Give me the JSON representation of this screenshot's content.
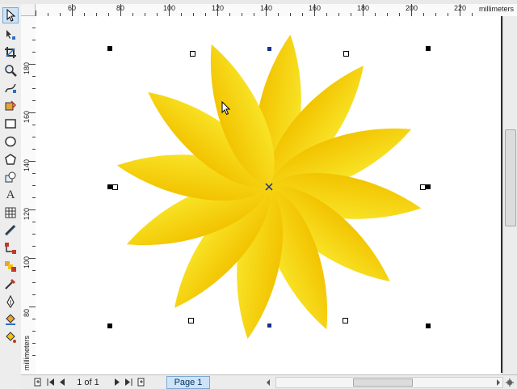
{
  "app": {
    "ruler_units": "millimeters",
    "horizontal_ticks": [
      "60",
      "80",
      "100",
      "120",
      "140",
      "160",
      "180",
      "200",
      "220"
    ],
    "vertical_ticks": [
      "180",
      "160",
      "140",
      "120",
      "100",
      "80"
    ],
    "vertical_units": "millimeters"
  },
  "toolbox": {
    "tools": [
      {
        "name": "pick-tool-icon",
        "selected": true
      },
      {
        "name": "shape-tool-icon",
        "selected": false
      },
      {
        "name": "crop-tool-icon",
        "selected": false
      },
      {
        "name": "zoom-tool-icon",
        "selected": false
      },
      {
        "name": "freehand-tool-icon",
        "selected": false
      },
      {
        "name": "smart-fill-tool-icon",
        "selected": false
      },
      {
        "name": "rectangle-tool-icon",
        "selected": false
      },
      {
        "name": "ellipse-tool-icon",
        "selected": false
      },
      {
        "name": "polygon-tool-icon",
        "selected": false
      },
      {
        "name": "basic-shapes-tool-icon",
        "selected": false
      },
      {
        "name": "text-tool-icon",
        "selected": false,
        "glyph": "A"
      },
      {
        "name": "table-tool-icon",
        "selected": false
      },
      {
        "name": "dimension-tool-icon",
        "selected": false
      },
      {
        "name": "connector-tool-icon",
        "selected": false
      },
      {
        "name": "blend-tool-icon",
        "selected": false
      },
      {
        "name": "eyedropper-tool-icon",
        "selected": false
      },
      {
        "name": "outline-pen-tool-icon",
        "selected": false
      },
      {
        "name": "fill-tool-icon",
        "selected": false
      },
      {
        "name": "interactive-fill-tool-icon",
        "selected": false
      }
    ]
  },
  "document": {
    "page_indicator": "1 of 1",
    "page_tab": "Page 1"
  },
  "colors": {
    "petal_light": "#f8e326",
    "petal_dark": "#f2c300",
    "page_border": "#2e2e2e",
    "selection_accent": "#1a2f8a"
  }
}
